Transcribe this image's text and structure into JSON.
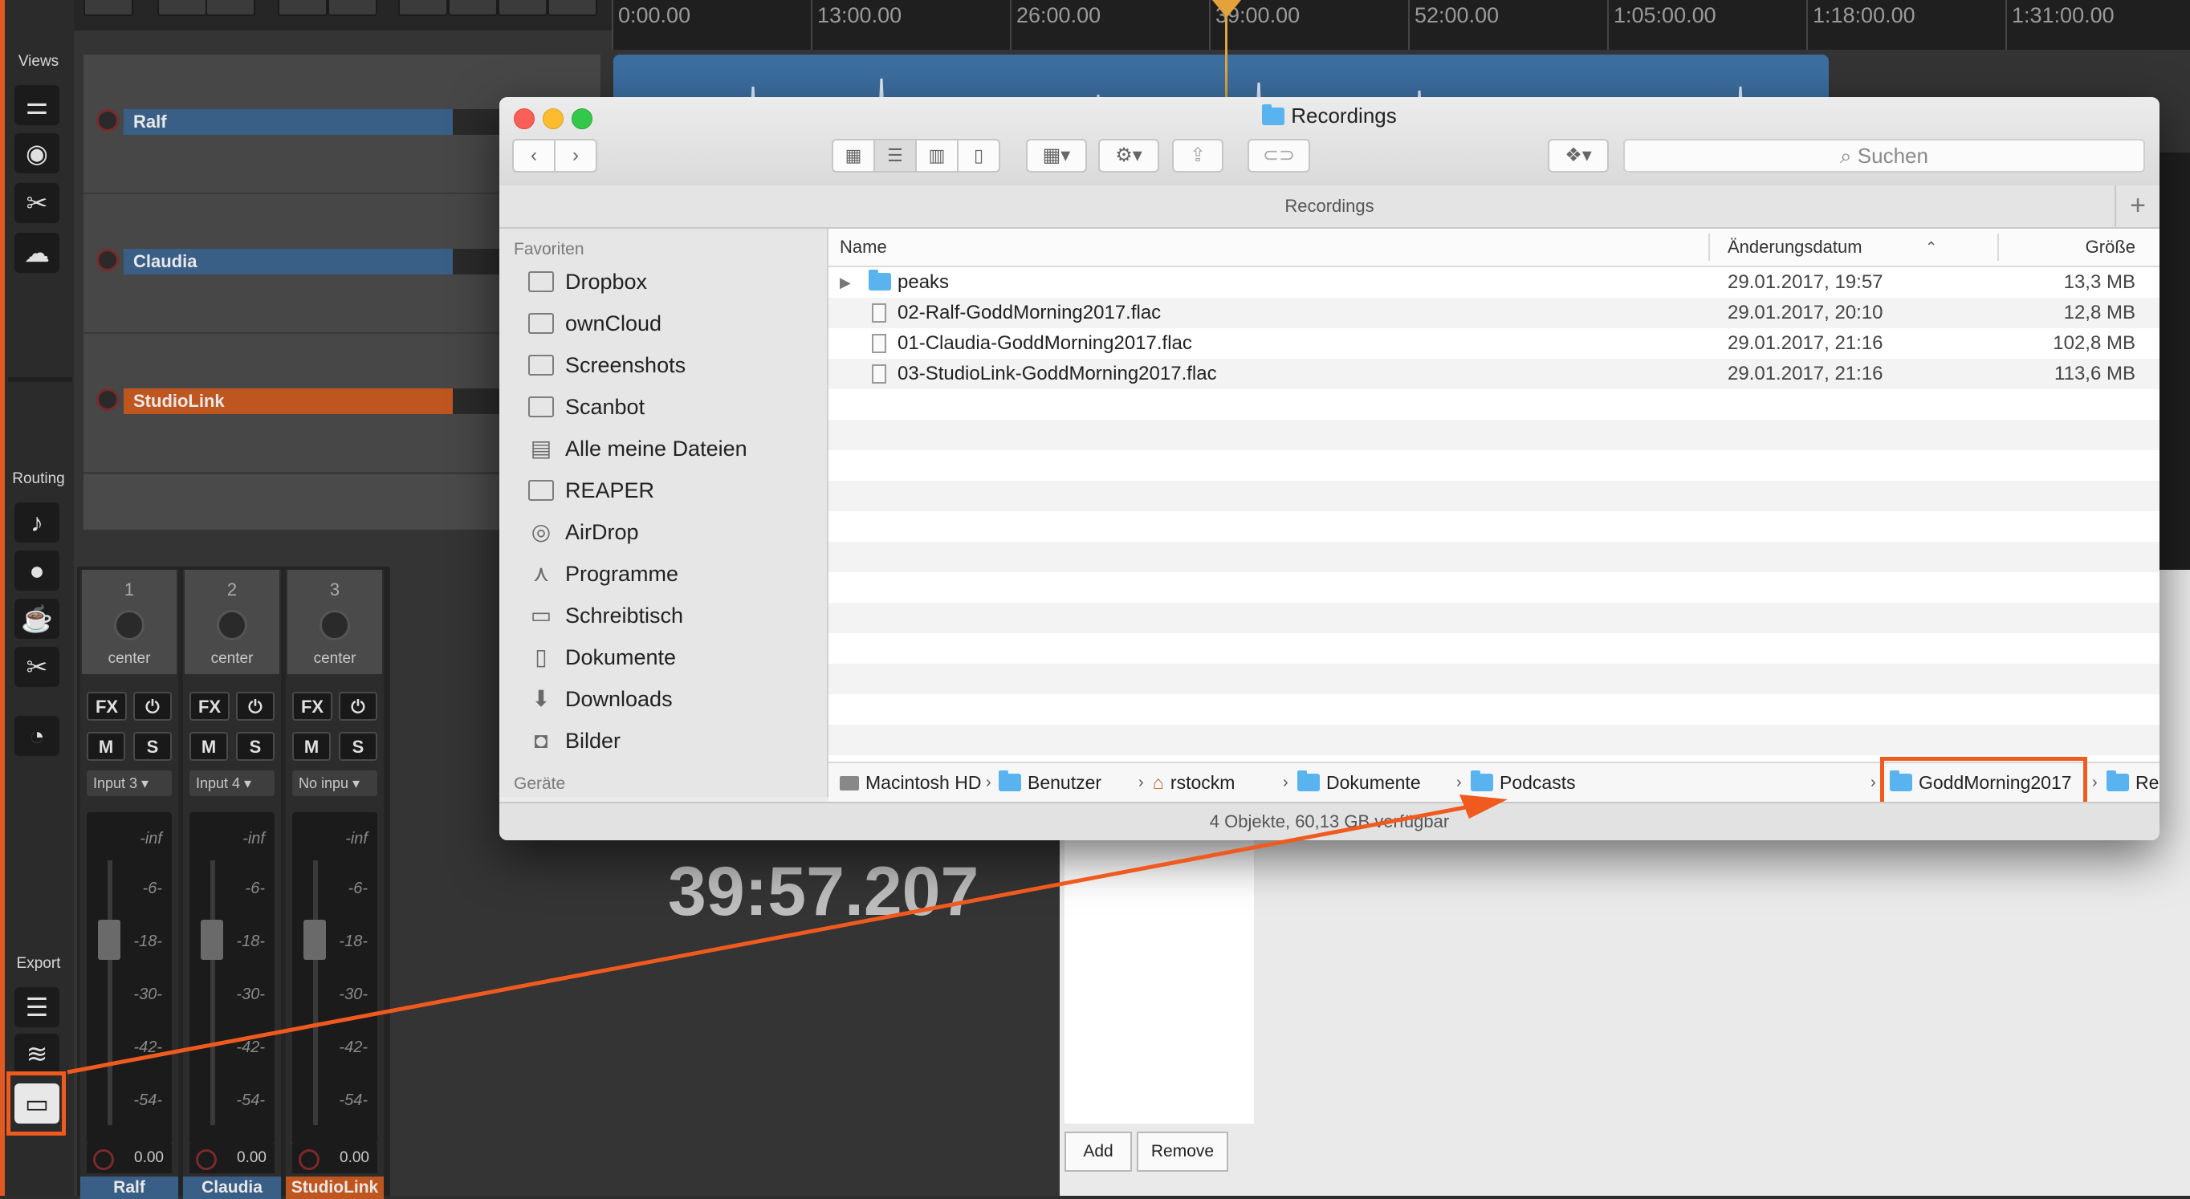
{
  "daw": {
    "ruler_labels": [
      "0:00.00",
      "13:00.00",
      "26:00.00",
      "39:00.00",
      "52:00.00",
      "1:05:00.00",
      "1:18:00.00",
      "1:31:00.00"
    ],
    "sidebar": {
      "views_label": "Views",
      "routing_label": "Routing",
      "export_label": "Export"
    },
    "tracks": [
      {
        "name": "Ralf",
        "color": "#3a5f86"
      },
      {
        "name": "Claudia",
        "color": "#3a5f86"
      },
      {
        "name": "StudioLink",
        "color": "#c0561f"
      }
    ],
    "track_m_label": "M",
    "mixer": {
      "strips": [
        {
          "number": "1",
          "pan": "center",
          "input": "Input 3",
          "name": "Ralf",
          "name_bg": "#3a5f86",
          "value": "0.00"
        },
        {
          "number": "2",
          "pan": "center",
          "input": "Input 4",
          "name": "Claudia",
          "name_bg": "#3a5f86",
          "value": "0.00"
        },
        {
          "number": "3",
          "pan": "center",
          "input": "No inpu",
          "name": "StudioLink",
          "name_bg": "#c0561f",
          "value": "0.00"
        }
      ],
      "fx_label": "FX",
      "mute_label": "M",
      "solo_label": "S",
      "db_marks": [
        "-inf",
        "-6-",
        "-18-",
        "-30-",
        "-42-",
        "-54-"
      ]
    },
    "timer": "39:57.207",
    "add_label": "Add",
    "remove_label": "Remove"
  },
  "finder": {
    "title": "Recordings",
    "search_placeholder": "Suchen",
    "path_title": "Recordings",
    "sidebar": {
      "favorites_heading": "Favoriten",
      "devices_heading": "Geräte",
      "items": [
        {
          "label": "Dropbox",
          "icon": "folder-icon"
        },
        {
          "label": "ownCloud",
          "icon": "folder-icon"
        },
        {
          "label": "Screenshots",
          "icon": "folder-icon"
        },
        {
          "label": "Scanbot",
          "icon": "folder-icon"
        },
        {
          "label": "Alle meine Dateien",
          "icon": "all-files-icon"
        },
        {
          "label": "REAPER",
          "icon": "folder-icon"
        },
        {
          "label": "AirDrop",
          "icon": "airdrop-icon"
        },
        {
          "label": "Programme",
          "icon": "applications-icon"
        },
        {
          "label": "Schreibtisch",
          "icon": "desktop-icon"
        },
        {
          "label": "Dokumente",
          "icon": "documents-icon"
        },
        {
          "label": "Downloads",
          "icon": "downloads-icon"
        },
        {
          "label": "Bilder",
          "icon": "camera-icon"
        }
      ]
    },
    "columns": {
      "name": "Name",
      "date": "Änderungsdatum",
      "size": "Größe"
    },
    "files": [
      {
        "name": "peaks",
        "date": "29.01.2017, 19:57",
        "size": "13,3 MB",
        "kind": "folder"
      },
      {
        "name": "02-Ralf-GoddMorning2017.flac",
        "date": "29.01.2017, 20:10",
        "size": "12,8 MB",
        "kind": "file"
      },
      {
        "name": "01-Claudia-GoddMorning2017.flac",
        "date": "29.01.2017, 21:16",
        "size": "102,8 MB",
        "kind": "file"
      },
      {
        "name": "03-StudioLink-GoddMorning2017.flac",
        "date": "29.01.2017, 21:16",
        "size": "113,6 MB",
        "kind": "file"
      }
    ],
    "breadcrumbs": [
      "Macintosh HD",
      "Benutzer",
      "rstockm",
      "Dokumente",
      "Podcasts",
      "GoddMorning2017",
      "Recordings"
    ],
    "status": "4 Objekte, 60,13 GB verfügbar"
  },
  "colors": {
    "highlight": "#f05a1e",
    "folder": "#58b3ef",
    "playhead": "#e4a23a"
  }
}
